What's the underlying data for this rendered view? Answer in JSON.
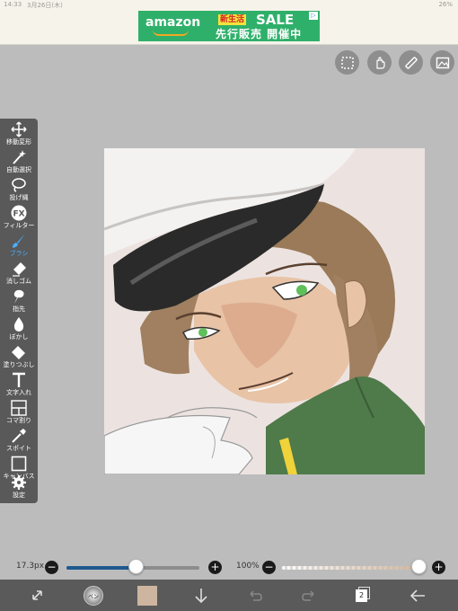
{
  "status": {
    "time": "14:33",
    "date": "3月26日(木)",
    "battery": "26%"
  },
  "ad": {
    "brand": "amazon",
    "badge": "新生活",
    "sale": "SALE",
    "subtitle": "先行販売 開催中",
    "adchoice": "▷"
  },
  "tools": [
    {
      "label": "移動変形",
      "icon": "move-arrows-icon"
    },
    {
      "label": "自動選択",
      "icon": "magic-wand-icon"
    },
    {
      "label": "投げ縄",
      "icon": "lasso-icon"
    },
    {
      "label": "フィルター",
      "icon": "fx-icon"
    },
    {
      "label": "ブラシ",
      "icon": "brush-icon",
      "active": true
    },
    {
      "label": "消しゴム",
      "icon": "eraser-icon"
    },
    {
      "label": "指先",
      "icon": "finger-smudge-icon"
    },
    {
      "label": "ぼかし",
      "icon": "blur-drop-icon"
    },
    {
      "label": "塗りつぶし",
      "icon": "fill-bucket-icon"
    },
    {
      "label": "文字入れ",
      "icon": "text-t-icon"
    },
    {
      "label": "コマ割り",
      "icon": "panel-divide-icon"
    },
    {
      "label": "スポイト",
      "icon": "eyedropper-icon"
    },
    {
      "label": "キャンバス",
      "icon": "canvas-icon"
    },
    {
      "label": "設定",
      "icon": "gear-icon"
    }
  ],
  "fx_text": "FX",
  "brush": {
    "size": "17.3px",
    "size_fraction": 0.2,
    "opacity": "100%",
    "opacity_fraction": 1.0,
    "brush_type": "ペン"
  },
  "colors": {
    "current": "#cdb5a0",
    "accent": "#4ab0ff"
  },
  "layers_count": "2"
}
